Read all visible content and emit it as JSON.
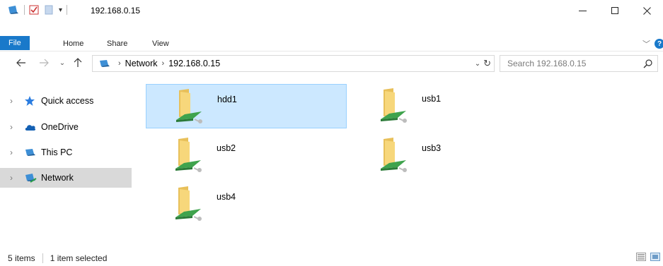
{
  "window": {
    "title": "192.168.0.15",
    "minimize": "—",
    "maximize": "☐",
    "close": "✕"
  },
  "ribbon": {
    "tabs": [
      "File",
      "Home",
      "Share",
      "View"
    ]
  },
  "address": {
    "crumbs": [
      "Network",
      "192.168.0.15"
    ],
    "search_placeholder": "Search 192.168.0.15"
  },
  "nav": {
    "items": [
      {
        "label": "Quick access",
        "icon": "star-icon"
      },
      {
        "label": "OneDrive",
        "icon": "cloud-icon"
      },
      {
        "label": "This PC",
        "icon": "pc-icon"
      },
      {
        "label": "Network",
        "icon": "network-icon",
        "selected": true
      }
    ]
  },
  "shares": [
    {
      "name": "hdd1",
      "selected": true
    },
    {
      "name": "usb1"
    },
    {
      "name": "usb2"
    },
    {
      "name": "usb3"
    },
    {
      "name": "usb4"
    }
  ],
  "status": {
    "count": "5 items",
    "selection": "1 item selected"
  },
  "colors": {
    "accent": "#1979ca",
    "selection": "#cce8ff",
    "nav_selected": "#d9d9d9"
  }
}
